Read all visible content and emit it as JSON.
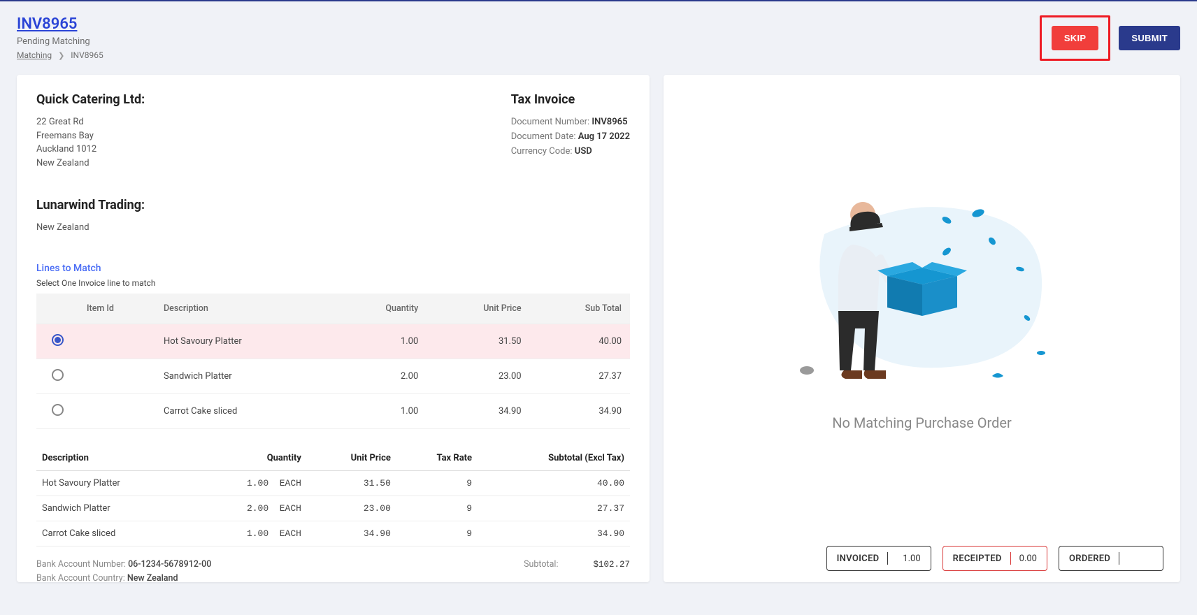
{
  "header": {
    "title": "INV8965",
    "status": "Pending Matching",
    "breadcrumb_root": "Matching",
    "breadcrumb_current": "INV8965",
    "skip_label": "SKIP",
    "submit_label": "SUBMIT"
  },
  "invoice": {
    "supplier_name": "Quick Catering Ltd:",
    "supplier_addr1": "22 Great Rd",
    "supplier_addr2": "Freemans Bay",
    "supplier_addr3": "Auckland  1012",
    "supplier_addr4": "New Zealand",
    "buyer_name": "Lunarwind Trading:",
    "buyer_addr1": "New Zealand",
    "tax_title": "Tax Invoice",
    "docnum_label": "Document Number:",
    "docnum": "INV8965",
    "docdate_label": "Document Date:",
    "docdate": "Aug 17 2022",
    "currency_label": "Currency Code:",
    "currency": "USD"
  },
  "lines": {
    "title": "Lines to Match",
    "subtitle": "Select One Invoice line to match",
    "cols": {
      "itemid": "Item Id",
      "desc": "Description",
      "qty": "Quantity",
      "price": "Unit Price",
      "sub": "Sub Total"
    },
    "rows": [
      {
        "selected": true,
        "desc": "Hot Savoury Platter",
        "qty": "1.00",
        "price": "31.50",
        "sub": "40.00"
      },
      {
        "selected": false,
        "desc": "Sandwich Platter",
        "qty": "2.00",
        "price": "23.00",
        "sub": "27.37"
      },
      {
        "selected": false,
        "desc": "Carrot Cake sliced",
        "qty": "1.00",
        "price": "34.90",
        "sub": "34.90"
      }
    ]
  },
  "detail": {
    "cols": {
      "desc": "Description",
      "qty": "Quantity",
      "price": "Unit Price",
      "tax": "Tax Rate",
      "sub": "Subtotal (Excl Tax)"
    },
    "rows": [
      {
        "desc": "Hot Savoury Platter",
        "qty": "1.00",
        "unit": "EACH",
        "price": "31.50",
        "tax": "9",
        "sub": "40.00"
      },
      {
        "desc": "Sandwich Platter",
        "qty": "2.00",
        "unit": "EACH",
        "price": "23.00",
        "tax": "9",
        "sub": "27.37"
      },
      {
        "desc": "Carrot Cake sliced",
        "qty": "1.00",
        "unit": "EACH",
        "price": "34.90",
        "tax": "9",
        "sub": "34.90"
      }
    ],
    "bank_num_label": "Bank Account Number:",
    "bank_num": "06-1234-5678912-00",
    "bank_country_label": "Bank Account Country:",
    "bank_country": "New Zealand",
    "subtotal_label": "Subtotal:",
    "subtotal": "$102.27"
  },
  "right": {
    "nomatch": "No Matching Purchase Order",
    "invoiced_label": "INVOICED",
    "invoiced_val": "1.00",
    "receipted_label": "RECEIPTED",
    "receipted_val": "0.00",
    "ordered_label": "ORDERED",
    "ordered_val": ""
  }
}
